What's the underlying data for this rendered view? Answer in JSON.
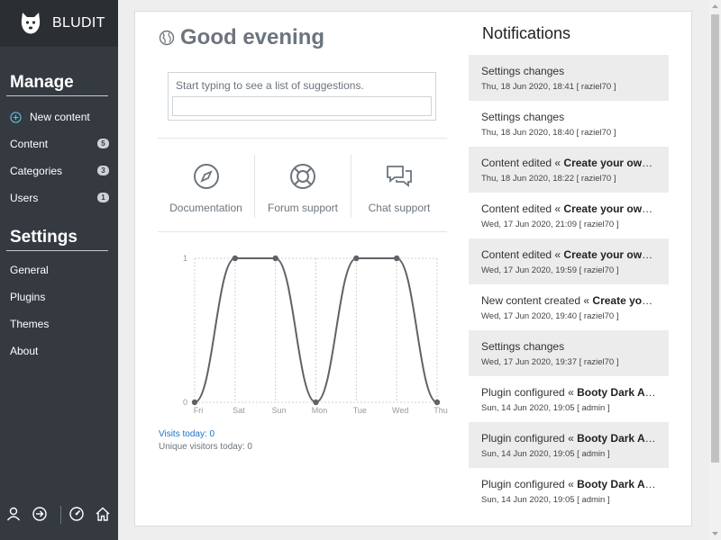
{
  "brand": {
    "name": "BLUDIT",
    "logo_icon": "bludit-dog-logo"
  },
  "sidebar": {
    "manage_title": "Manage",
    "settings_title": "Settings",
    "new_content": "New content",
    "items": [
      {
        "label": "Content",
        "badge": "5"
      },
      {
        "label": "Categories",
        "badge": "3"
      },
      {
        "label": "Users",
        "badge": "1"
      }
    ],
    "settings_items": [
      {
        "label": "General"
      },
      {
        "label": "Plugins"
      },
      {
        "label": "Themes"
      },
      {
        "label": "About"
      }
    ],
    "bottom_icons": [
      "user-icon",
      "logout-icon",
      "dashboard-icon",
      "home-icon"
    ]
  },
  "greeting": "Good evening",
  "search": {
    "hint": "Start typing to see a list of suggestions.",
    "value": ""
  },
  "quick_links": [
    {
      "label": "Documentation",
      "icon": "compass-icon"
    },
    {
      "label": "Forum support",
      "icon": "lifebuoy-icon"
    },
    {
      "label": "Chat support",
      "icon": "chat-icon"
    }
  ],
  "chart_data": {
    "type": "line",
    "categories": [
      "Fri",
      "Sat",
      "Sun",
      "Mon",
      "Tue",
      "Wed",
      "Thu"
    ],
    "values": [
      0,
      1,
      1,
      0,
      1,
      1,
      0
    ],
    "ylim": [
      0,
      1
    ],
    "yticks": [
      "0",
      "1"
    ],
    "grid": true,
    "color": "#5f6368"
  },
  "stats": {
    "visits_today": "Visits today: 0",
    "unique_visitors": "Unique visitors today: 0"
  },
  "notifications": {
    "title": "Notifications",
    "items": [
      {
        "text": "Settings changes",
        "bold": "",
        "meta": "Thu, 18 Jun 2020, 18:41 [ raziel70 ]"
      },
      {
        "text": "Settings changes",
        "bold": "",
        "meta": "Thu, 18 Jun 2020, 18:40 [ raziel70 ]"
      },
      {
        "text": "Content edited « ",
        "bold": "Create your own …",
        "meta": "Thu, 18 Jun 2020, 18:22 [ raziel70 ]"
      },
      {
        "text": "Content edited « ",
        "bold": "Create your own …",
        "meta": "Wed, 17 Jun 2020, 21:09 [ raziel70 ]"
      },
      {
        "text": "Content edited « ",
        "bold": "Create your own …",
        "meta": "Wed, 17 Jun 2020, 19:59 [ raziel70 ]"
      },
      {
        "text": "New content created « ",
        "bold": "Create your …",
        "meta": "Wed, 17 Jun 2020, 19:40 [ raziel70 ]"
      },
      {
        "text": "Settings changes",
        "bold": "",
        "meta": "Wed, 17 Jun 2020, 19:37 [ raziel70 ]"
      },
      {
        "text": "Plugin configured « ",
        "bold": "Booty Dark Ad…",
        "meta": "Sun, 14 Jun 2020, 19:05 [ admin ]"
      },
      {
        "text": "Plugin configured « ",
        "bold": "Booty Dark Ad…",
        "meta": "Sun, 14 Jun 2020, 19:05 [ admin ]"
      },
      {
        "text": "Plugin configured « ",
        "bold": "Booty Dark Ad…",
        "meta": "Sun, 14 Jun 2020, 19:05 [ admin ]"
      }
    ]
  }
}
